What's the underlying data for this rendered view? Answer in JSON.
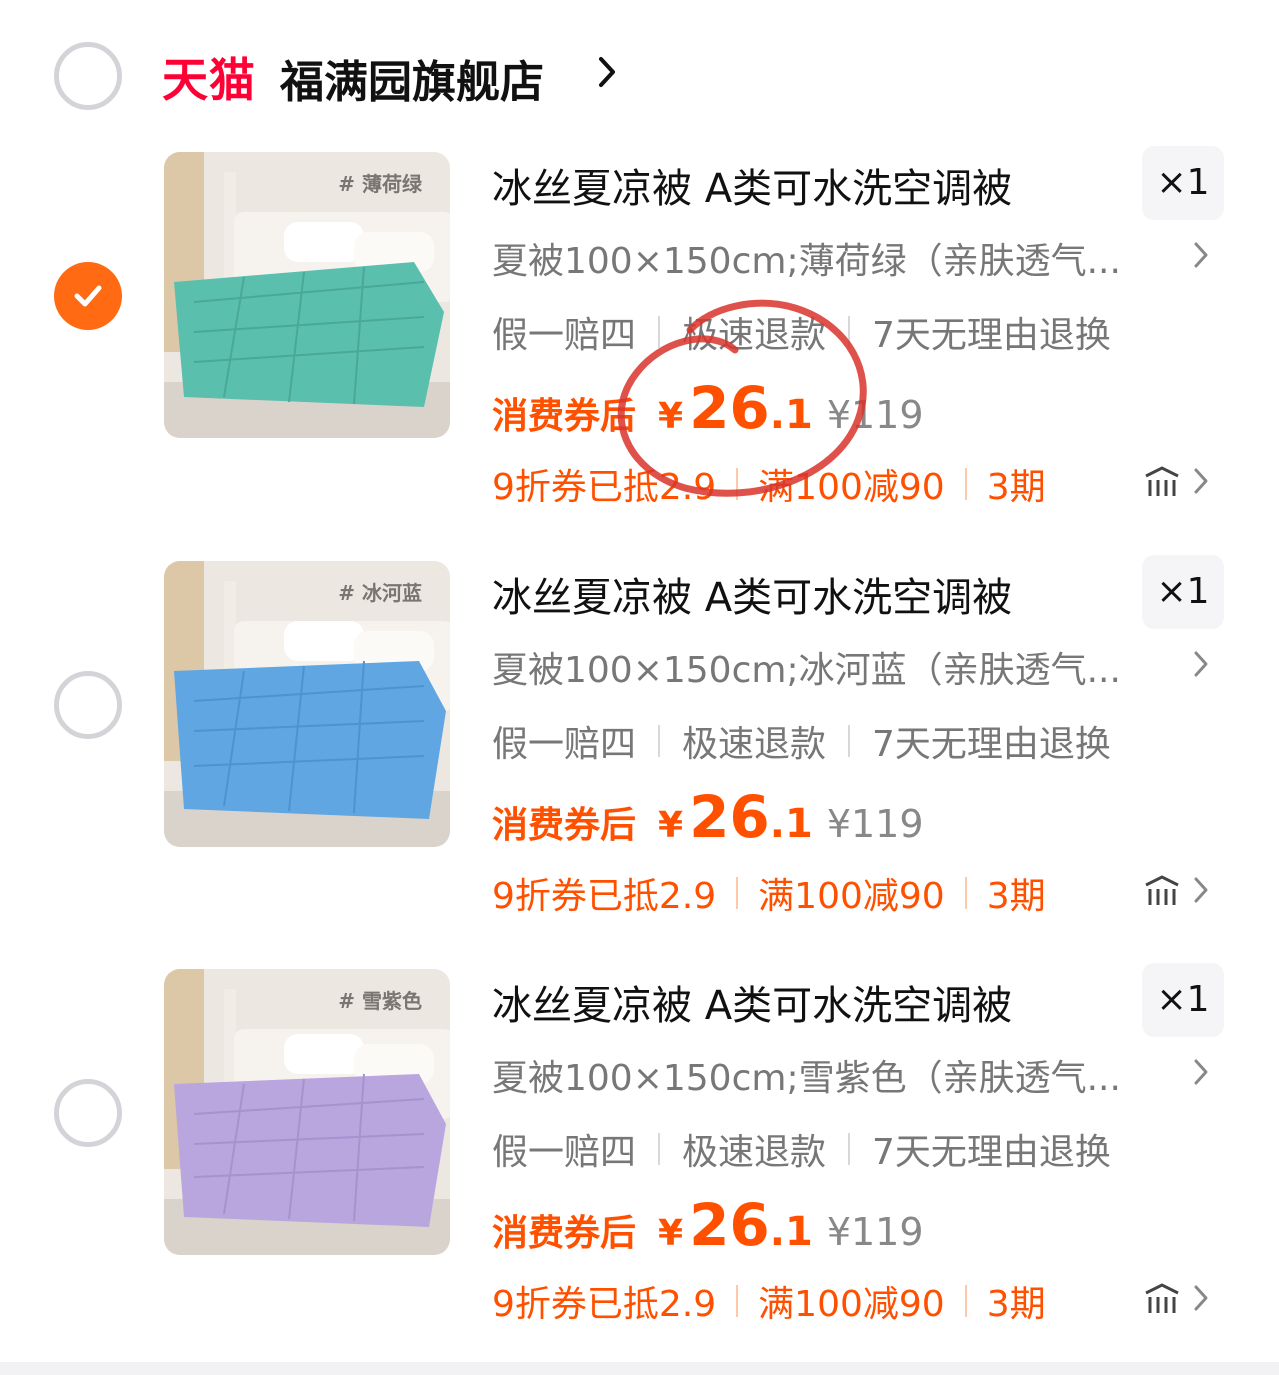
{
  "shop": {
    "brand": "天猫",
    "name": "福满园旗舰店",
    "brand_color": "#ff0036"
  },
  "colors": {
    "accent": "#ff5000",
    "checkbox_checked": "#ff6a12",
    "annotation_circle": "#d9342b"
  },
  "items": [
    {
      "selected": true,
      "tag": "# 薄荷绿",
      "title": "冰丝夏凉被 A类可水洗空调被",
      "qty": "×1",
      "sku": "夏被100×150cm;薄荷绿（亲肤透气...",
      "services": [
        "假一赔四",
        "极速退款",
        "7天无理由退换"
      ],
      "price_label": "消费券后",
      "currency": "¥",
      "price_int": "26",
      "price_dec": ".1",
      "orig_price": "¥119",
      "promos": [
        "9折券已抵2.9",
        "满100减90",
        "3期"
      ],
      "color_name": "mint-green",
      "color_hex": "#5bbfae"
    },
    {
      "selected": false,
      "tag": "# 冰河蓝",
      "title": "冰丝夏凉被 A类可水洗空调被",
      "qty": "×1",
      "sku": "夏被100×150cm;冰河蓝（亲肤透气...",
      "services": [
        "假一赔四",
        "极速退款",
        "7天无理由退换"
      ],
      "price_label": "消费券后",
      "currency": "¥",
      "price_int": "26",
      "price_dec": ".1",
      "orig_price": "¥119",
      "promos": [
        "9折券已抵2.9",
        "满100减90",
        "3期"
      ],
      "color_name": "glacier-blue",
      "color_hex": "#5fa6e2"
    },
    {
      "selected": false,
      "tag": "# 雪紫色",
      "title": "冰丝夏凉被 A类可水洗空调被",
      "qty": "×1",
      "sku": "夏被100×150cm;雪紫色（亲肤透气...",
      "services": [
        "假一赔四",
        "极速退款",
        "7天无理由退换"
      ],
      "price_label": "消费券后",
      "currency": "¥",
      "price_int": "26",
      "price_dec": ".1",
      "orig_price": "¥119",
      "promos": [
        "9折券已抵2.9",
        "满100减90",
        "3期"
      ],
      "color_name": "snow-purple",
      "color_hex": "#b9a6df"
    }
  ]
}
